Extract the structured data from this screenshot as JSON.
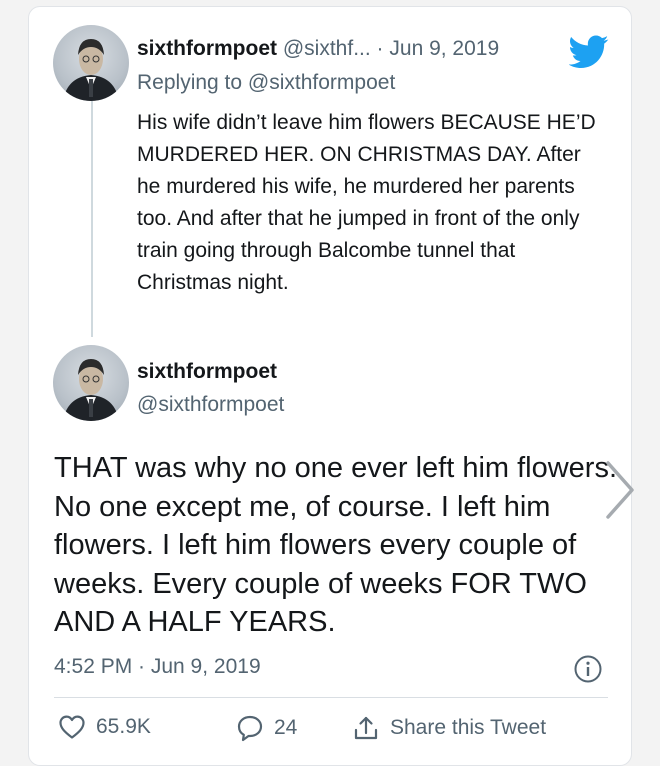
{
  "tweet1": {
    "display_name": "sixthformpoet",
    "handle": "@sixthf...",
    "separator": "·",
    "date": "Jun 9, 2019",
    "replying_prefix": "Replying to",
    "replying_to": "@sixthformpoet",
    "text": "His wife didn’t leave him flowers BECAUSE HE’D MURDERED HER. ON CHRISTMAS DAY. After he murdered his wife, he murdered her parents too. And after that he jumped in front of the only train going through Balcombe tunnel that Christmas night."
  },
  "tweet2": {
    "display_name": "sixthformpoet",
    "handle": "@sixthformpoet",
    "text": "THAT was why no one ever left him flowers. No one except me, of course. I left him flowers. I left him flowers every couple of weeks. Every couple of weeks FOR TWO AND A HALF YEARS.",
    "timestamp": "4:52 PM · Jun 9, 2019",
    "likes": "65.9K",
    "replies": "24",
    "share_label": "Share this Tweet"
  },
  "icons": {
    "brand": "twitter-bird-icon",
    "like": "heart-icon",
    "reply": "speech-bubble-icon",
    "share": "share-icon",
    "info": "info-icon",
    "next": "chevron-right-icon"
  },
  "colors": {
    "twitter_blue": "#1da1f2",
    "text_primary": "#14171a",
    "text_secondary": "#536471"
  }
}
